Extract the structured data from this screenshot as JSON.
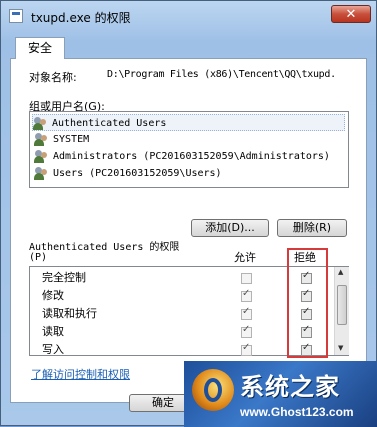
{
  "window": {
    "title": "txupd.exe 的权限",
    "close_label": "✕"
  },
  "tab": {
    "label": "安全"
  },
  "object": {
    "label": "对象名称:",
    "value": "D:\\Program Files (x86)\\Tencent\\QQ\\txupd."
  },
  "groups": {
    "label": "组或用户名(G):",
    "items": [
      "Authenticated Users",
      "SYSTEM",
      "Administrators (PC201603152059\\Administrators)",
      "Users (PC201603152059\\Users)"
    ]
  },
  "buttons": {
    "add": "添加(D)...",
    "remove": "删除(R)",
    "ok": "确定"
  },
  "permissions": {
    "title": "Authenticated Users 的权限",
    "title_suffix": "(P)",
    "allow_header": "允许",
    "deny_header": "拒绝",
    "rows": [
      {
        "name": "完全控制",
        "allow": false,
        "deny": true
      },
      {
        "name": "修改",
        "allow": true,
        "deny": true
      },
      {
        "name": "读取和执行",
        "allow": true,
        "deny": true
      },
      {
        "name": "读取",
        "allow": true,
        "deny": true
      },
      {
        "name": "写入",
        "allow": true,
        "deny": true
      }
    ]
  },
  "link": {
    "label": "了解访问控制和权限"
  },
  "watermark": {
    "title": "系统之家",
    "url": "www.Ghost123.com"
  }
}
